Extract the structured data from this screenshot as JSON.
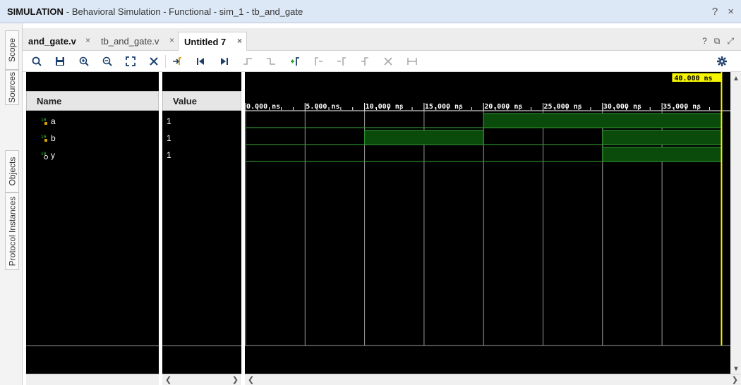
{
  "titlebar": {
    "title_strong": "SIMULATION",
    "title_rest": "- Behavioral Simulation - Functional - sim_1 - tb_and_gate",
    "help_icon": "?",
    "close_icon": "×"
  },
  "side_tabs": [
    "Scope",
    "Sources",
    "Objects",
    "Protocol Instances"
  ],
  "tabs": [
    {
      "label": "and_gate.v",
      "close": "×"
    },
    {
      "label": "tb_and_gate.v",
      "close": "×"
    },
    {
      "label": "Untitled 7",
      "close": "×",
      "active": true
    }
  ],
  "tab_icons": {
    "help": "?",
    "restore": "⧉",
    "maximize": "⤢"
  },
  "toolbar": {
    "buttons": [
      "search-icon",
      "save-icon",
      "zoom-in-icon",
      "zoom-out-icon",
      "zoom-fit-icon",
      "swap-cursor-icon",
      "goto-cursor-icon",
      "go-to-time-zero-icon",
      "go-to-last-time-icon",
      "previous-transition-icon",
      "next-transition-icon",
      "add-marker-icon",
      "previous-marker-icon",
      "next-marker-icon",
      "swap-markers-icon",
      "delete-marker-icon",
      "snap-icon"
    ],
    "settings_icon": "gear-icon"
  },
  "waveform": {
    "name_header": "Name",
    "value_header": "Value",
    "cursor_label": "40.000 ns",
    "time_labels": [
      "0.000 ns",
      "5.000 ns",
      "10.000 ns",
      "15.000 ns",
      "20.000 ns",
      "25.000 ns",
      "30.000 ns",
      "35.000 ns"
    ],
    "signals": [
      {
        "name": "a",
        "value": "1",
        "icon": "bit-signal-icon",
        "highs": [
          [
            20,
            40
          ]
        ]
      },
      {
        "name": "b",
        "value": "1",
        "icon": "bit-signal-icon",
        "highs": [
          [
            10,
            20
          ],
          [
            30,
            40
          ]
        ]
      },
      {
        "name": "y",
        "value": "1",
        "icon": "bit-signal-icon",
        "highs": [
          [
            30,
            40
          ]
        ]
      }
    ],
    "colors": {
      "wave_high": "#2d8a2d",
      "wave_fill": "#0a4a0a",
      "cursor": "#f5f500",
      "grid": "#9a9a9a",
      "label_bg": "#f5f500"
    }
  }
}
